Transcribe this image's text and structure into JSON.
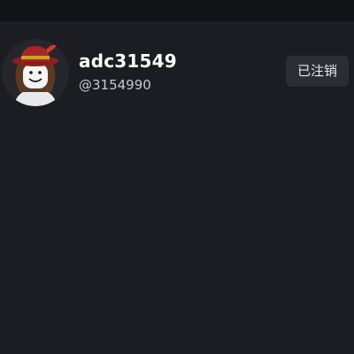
{
  "profile": {
    "username": "adc31549",
    "handle": "@3154990",
    "status_label": "已注销"
  },
  "colors": {
    "background": "#1c1d22",
    "topbar": "#121317",
    "badge_bg": "#2b2d33",
    "username": "#ffffff",
    "handle": "#c8c9cf"
  },
  "icons": {
    "avatar": "roblox-avatar-hat"
  }
}
